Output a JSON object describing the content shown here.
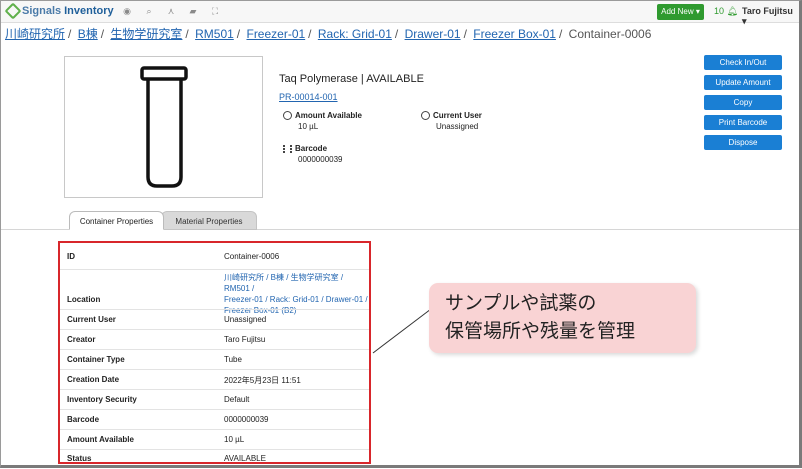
{
  "app": {
    "brand_prefix": "Signals",
    "brand_name": "Inventory",
    "add_new": "Add New",
    "notifications": "10",
    "user": "Taro Fujitsu"
  },
  "nav_icons": [
    "location-icon",
    "search-icon",
    "hierarchy-icon",
    "folder-icon",
    "expand-icon"
  ],
  "breadcrumb": {
    "items": [
      "川崎研究所",
      "B棟",
      "生物学研究室",
      "RM501",
      "Freezer-01",
      "Rack: Grid-01",
      "Drawer-01",
      "Freezer Box-01"
    ],
    "current": "Container-0006"
  },
  "summary": {
    "title": "Taq Polymerase | AVAILABLE",
    "id": "PR-00014-001",
    "amount_label": "Amount Available",
    "amount_value": "10 µL",
    "user_label": "Current User",
    "user_value": "Unassigned",
    "barcode_label": "Barcode",
    "barcode_value": "0000000039"
  },
  "actions": [
    "Check In/Out",
    "Update Amount",
    "Copy",
    "Print Barcode",
    "Dispose"
  ],
  "tabs": {
    "active": "Container Properties",
    "inactive": "Material Properties"
  },
  "properties": {
    "id": {
      "label": "ID",
      "value": "Container-0006"
    },
    "location": {
      "label": "Location",
      "lines": [
        "川崎研究所 / B棟 / 生物学研究室 / RM501 /",
        "Freezer-01 / Rack: Grid-01 / Drawer-01 /",
        "Freezer Box-01 (B2)"
      ]
    },
    "current_user": {
      "label": "Current User",
      "value": "Unassigned"
    },
    "creator": {
      "label": "Creator",
      "value": "Taro Fujitsu"
    },
    "container_type": {
      "label": "Container Type",
      "value": "Tube"
    },
    "creation_date": {
      "label": "Creation Date",
      "value": "2022年5月23日 11:51"
    },
    "inventory_security": {
      "label": "Inventory Security",
      "value": "Default"
    },
    "barcode": {
      "label": "Barcode",
      "value": "0000000039"
    },
    "amount_available": {
      "label": "Amount Available",
      "value": "10 µL"
    },
    "status": {
      "label": "Status",
      "value": "AVAILABLE"
    }
  },
  "callout": {
    "line1": "サンプルや試薬の",
    "line2": "保管場所や残量を管理"
  },
  "colors": {
    "highlight": "#d8262b",
    "callout_bg": "#f9d3d4",
    "primary_button": "#1a7fd4",
    "add_new": "#2f9a2f",
    "link": "#2265b0"
  }
}
